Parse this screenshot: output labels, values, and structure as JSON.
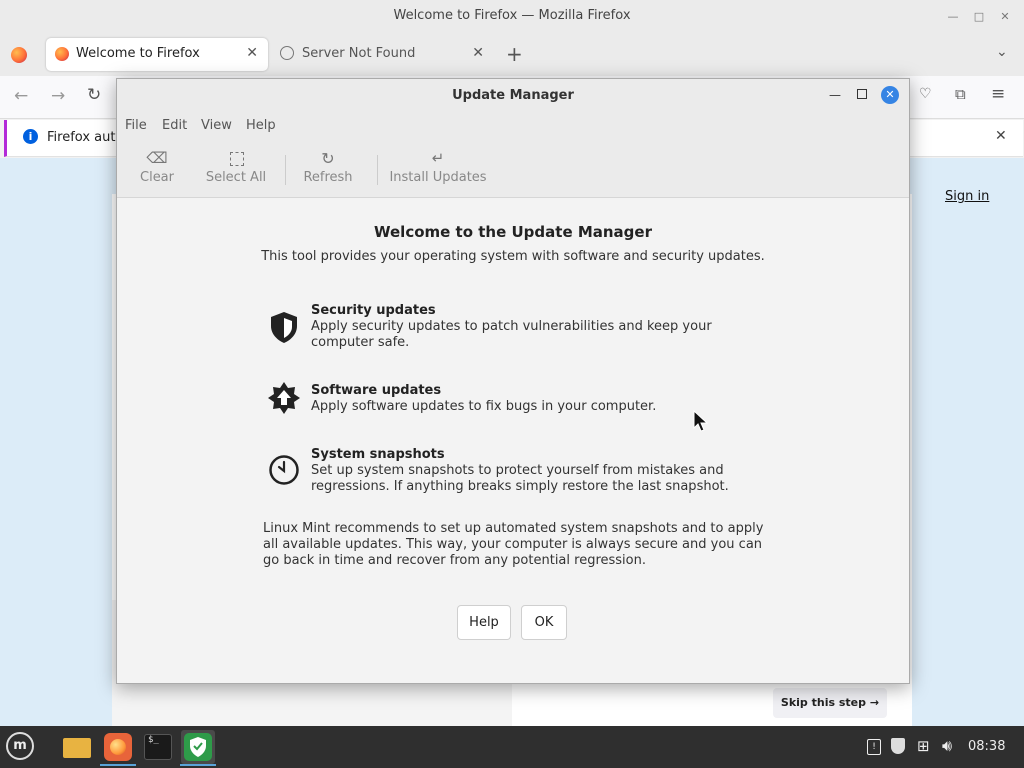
{
  "firefox": {
    "window_title": "Welcome to Firefox — Mozilla Firefox",
    "tabs": [
      {
        "label": "Welcome to Firefox"
      },
      {
        "label": "Server Not Found"
      }
    ],
    "notice_text": "Firefox auto",
    "sign_in": "Sign in",
    "skip_step": "Skip this step →"
  },
  "update_manager": {
    "title": "Update Manager",
    "menu": [
      "File",
      "Edit",
      "View",
      "Help"
    ],
    "toolbar": [
      {
        "icon": "eraser-icon",
        "label": "Clear"
      },
      {
        "icon": "select-all-icon",
        "label": "Select All"
      },
      {
        "icon": "refresh-icon",
        "label": "Refresh"
      },
      {
        "icon": "install-icon",
        "label": "Install Updates"
      }
    ],
    "heading": "Welcome to the Update Manager",
    "subtitle": "This tool provides your operating system with software and security updates.",
    "features": [
      {
        "icon": "shield-icon",
        "title": "Security updates",
        "desc": "Apply security updates to patch vulnerabilities and keep your computer safe."
      },
      {
        "icon": "software-update-icon",
        "title": "Software updates",
        "desc": "Apply software updates to fix bugs in your computer."
      },
      {
        "icon": "clock-icon",
        "title": "System snapshots",
        "desc": "Set up system snapshots to protect yourself from mistakes and regressions. If anything breaks simply restore the last snapshot."
      }
    ],
    "recommendation": "Linux Mint recommends to set up automated system snapshots and to apply all available updates. This way, your computer is always secure and you can go back in time and recover from any potential regression.",
    "buttons": {
      "help": "Help",
      "ok": "OK"
    }
  },
  "taskbar": {
    "clock": "08:38"
  },
  "colors": {
    "accent_blue": "#3584e4",
    "mint_green": "#2e9b49",
    "firefox_orange": "#ff7139"
  }
}
